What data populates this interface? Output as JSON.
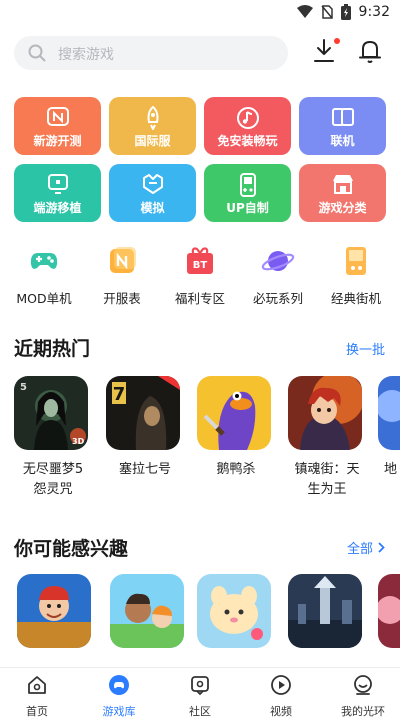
{
  "status_bar": {
    "time": "9:32"
  },
  "search": {
    "placeholder": "搜索游戏"
  },
  "tiles": [
    {
      "label": "新游开测",
      "color": "#f77a52",
      "icon": "n-badge-icon"
    },
    {
      "label": "国际服",
      "color": "#f0b84a",
      "icon": "rocket-icon"
    },
    {
      "label": "免安装畅玩",
      "color": "#f25a60",
      "icon": "music-note-icon"
    },
    {
      "label": "联机",
      "color": "#7b8df2",
      "icon": "cards-icon"
    },
    {
      "label": "端游移植",
      "color": "#2cc4a6",
      "icon": "monitor-icon"
    },
    {
      "label": "模拟",
      "color": "#3ab5f0",
      "icon": "helmet-icon"
    },
    {
      "label": "UP自制",
      "color": "#3fc86a",
      "icon": "gameboy-icon"
    },
    {
      "label": "游戏分类",
      "color": "#f2766e",
      "icon": "shop-icon"
    }
  ],
  "quick_links": [
    {
      "label": "MOD单机",
      "icon": "gamepad-icon"
    },
    {
      "label": "开服表",
      "icon": "server-list-icon"
    },
    {
      "label": "福利专区",
      "icon": "bt-gift-icon"
    },
    {
      "label": "必玩系列",
      "icon": "planet-icon"
    },
    {
      "label": "经典街机",
      "icon": "arcade-icon"
    }
  ],
  "recent_hot": {
    "title": "近期热门",
    "action": "换一批",
    "games": [
      {
        "name_line1": "无尽噩梦5",
        "name_line2": "怨灵咒",
        "art": "horror-girl-art"
      },
      {
        "name_line1": "塞拉七号",
        "name_line2": "",
        "art": "hooded-man-art"
      },
      {
        "name_line1": "鹅鸭杀",
        "name_line2": "",
        "art": "purple-goose-art"
      },
      {
        "name_line1": "镇魂街：天",
        "name_line2": "生为王",
        "art": "fire-warrior-art"
      },
      {
        "name_line1": "地",
        "name_line2": "",
        "art": "partial-art"
      }
    ]
  },
  "interest": {
    "title": "你可能感兴趣",
    "action": "全部",
    "games": [
      {
        "art": "subway-runner-art"
      },
      {
        "art": "kids-world-art"
      },
      {
        "art": "cute-pet-art"
      },
      {
        "art": "night-tower-art"
      },
      {
        "art": "partial-art-2"
      }
    ]
  },
  "tabbar": [
    {
      "label": "首页",
      "icon": "home-icon",
      "active": false
    },
    {
      "label": "游戏库",
      "icon": "game-library-icon",
      "active": true
    },
    {
      "label": "社区",
      "icon": "community-icon",
      "active": false
    },
    {
      "label": "视频",
      "icon": "video-icon",
      "active": false
    },
    {
      "label": "我的光环",
      "icon": "profile-icon",
      "active": false
    }
  ],
  "colors": {
    "accent": "#2b7cff",
    "text": "#1a1a1a"
  }
}
